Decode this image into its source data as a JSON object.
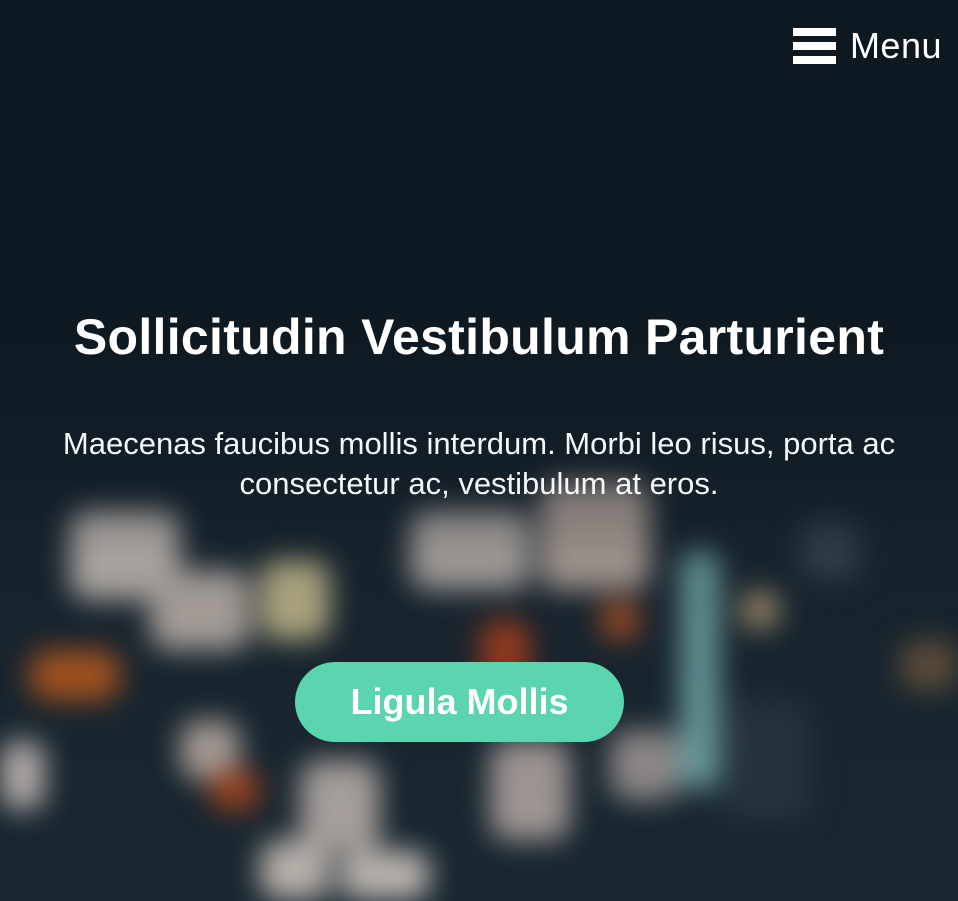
{
  "nav": {
    "menu_label": "Menu"
  },
  "hero": {
    "headline": "Sollicitudin Vestibulum Parturient",
    "lead": "Maecenas faucibus mollis interdum. Morbi leo risus, porta ac consectetur ac, vestibulum at eros.",
    "cta_label": "Ligula Mollis"
  },
  "colors": {
    "background": "#0f1a23",
    "accent": "#5bd4b0",
    "text": "#ffffff"
  },
  "icons": {
    "menu": "hamburger-icon"
  }
}
